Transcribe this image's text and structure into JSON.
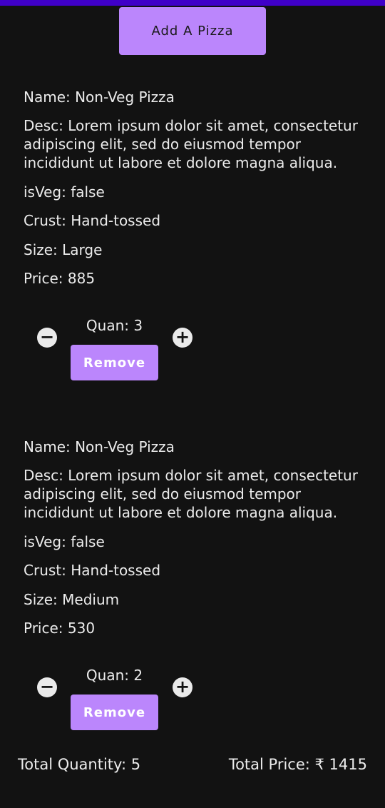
{
  "header": {
    "add_pizza_label": "Add A Pizza"
  },
  "pizzas": [
    {
      "name": "Name: Non-Veg Pizza",
      "desc": "Desc: Lorem ipsum dolor sit amet, consectetur adipiscing elit, sed do eiusmod tempor incididunt ut labore et dolore magna aliqua.",
      "is_veg": "isVeg: false",
      "crust": "Crust: Hand-tossed",
      "size": "Size: Large",
      "price": "Price: 885",
      "quantity": "Quan: 3",
      "remove_label": "Remove"
    },
    {
      "name": "Name: Non-Veg Pizza",
      "desc": "Desc: Lorem ipsum dolor sit amet, consectetur adipiscing elit, sed do eiusmod tempor incididunt ut labore et dolore magna aliqua.",
      "is_veg": "isVeg: false",
      "crust": "Crust: Hand-tossed",
      "size": "Size: Medium",
      "price": "Price: 530",
      "quantity": "Quan: 2",
      "remove_label": "Remove"
    }
  ],
  "footer": {
    "total_quantity": "Total Quantity: 5",
    "total_price": "Total Price: ₹ 1415"
  },
  "icons": {
    "minus": "minus-circle-icon",
    "plus": "plus-circle-icon"
  },
  "colors": {
    "background": "#121212",
    "accent": "#bb86fc",
    "status_bar": "#3f00c8",
    "text": "#ececec"
  }
}
